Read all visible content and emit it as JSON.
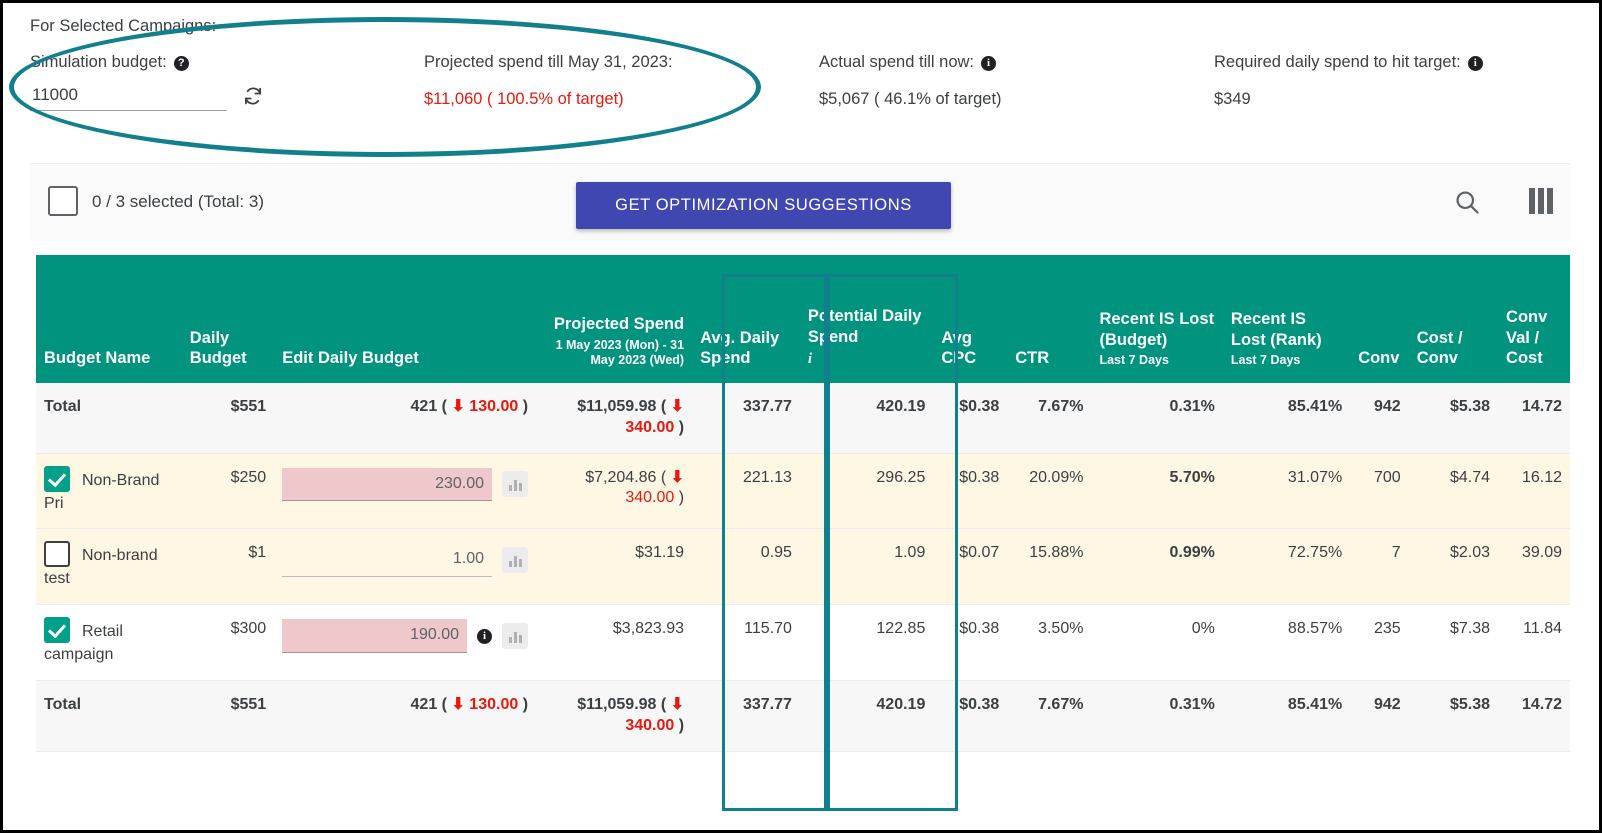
{
  "summary": {
    "title": "For Selected Campaigns:",
    "metrics": [
      {
        "label": "Simulation budget:",
        "icon": "help-icon",
        "input_value": "11000",
        "input_placeholder": "",
        "refresh_icon": "refresh-icon"
      },
      {
        "label": "Projected spend till May 31, 2023:",
        "value": "$11,060 ( 100.5% of target)",
        "value_color": "#e8190e"
      },
      {
        "label": "Actual spend till now:",
        "icon": "info-icon",
        "value": "$5,067 ( 46.1% of target)"
      },
      {
        "label": "Required daily spend to hit target:",
        "icon": "info-icon",
        "value": "$349"
      }
    ]
  },
  "toolbar": {
    "select_all_checked": false,
    "selected_text": "0 / 3 selected (Total: 3)",
    "button_label": "GET OPTIMIZATION SUGGESTIONS",
    "button_color": "#4147b0",
    "search_icon": "search-icon",
    "columns_icon": "columns-icon"
  },
  "table": {
    "header_color": "#00947e",
    "columns": [
      {
        "label": "Budget Name",
        "sub": ""
      },
      {
        "label": "Daily Budget",
        "sub": ""
      },
      {
        "label": "Edit Daily Budget",
        "sub": ""
      },
      {
        "label": "Projected Spend",
        "sub": "1 May 2023 (Mon) - 31 May 2023 (Wed)"
      },
      {
        "label": "Avg. Daily Spend",
        "sub": ""
      },
      {
        "label": "Potential Daily Spend",
        "sub": ""
      },
      {
        "label": "Avg CPC",
        "sub": ""
      },
      {
        "label": "CTR",
        "sub": ""
      },
      {
        "label": "Recent IS Lost (Budget)",
        "sub": "Last 7 Days"
      },
      {
        "label": "Recent IS Lost (Rank)",
        "sub": "Last 7 Days"
      },
      {
        "label": "Conv",
        "sub": ""
      },
      {
        "label": "Cost / Conv",
        "sub": ""
      },
      {
        "label": "Conv Val / Cost",
        "sub": ""
      }
    ],
    "total_row": {
      "name": "Total",
      "daily_budget": "$551",
      "edit_prefix": "421 (",
      "edit_delta": "130.00",
      "edit_suffix": ")",
      "projected_spend": "$11,059.98  (",
      "projected_delta": "340.00",
      "projected_suffix": ")",
      "avg_daily_spend": "337.77",
      "potential_daily_spend": "420.19",
      "avg_cpc": "$0.38",
      "ctr": "7.67%",
      "is_lost_budget": "0.31%",
      "is_lost_rank": "85.41%",
      "conv": "942",
      "cost_per_conv": "$5.38",
      "conv_val_cost": "14.72"
    },
    "rows": [
      {
        "checked": true,
        "name": "Non-Brand Pri",
        "daily_budget": "$250",
        "edit_value": "230.00",
        "edit_changed": true,
        "has_info": false,
        "projected_spend": "$7,204.86  (",
        "projected_delta": "340.00",
        "projected_suffix": ")",
        "avg_daily_spend": "221.13",
        "potential_daily_spend": "296.25",
        "avg_cpc": "$0.38",
        "ctr": "20.09%",
        "is_lost_budget": "5.70%",
        "is_lost_budget_bold": true,
        "is_lost_rank": "31.07%",
        "conv": "700",
        "cost_per_conv": "$4.74",
        "conv_val_cost": "16.12"
      },
      {
        "checked": false,
        "name": "Non-brand test",
        "daily_budget": "$1",
        "edit_value": "1.00",
        "edit_changed": false,
        "has_info": false,
        "projected_spend": "$31.19",
        "projected_delta": "",
        "projected_suffix": "",
        "avg_daily_spend": "0.95",
        "potential_daily_spend": "1.09",
        "avg_cpc": "$0.07",
        "ctr": "15.88%",
        "is_lost_budget": "0.99%",
        "is_lost_budget_bold": true,
        "is_lost_rank": "72.75%",
        "conv": "7",
        "cost_per_conv": "$2.03",
        "conv_val_cost": "39.09"
      },
      {
        "checked": true,
        "name": "Retail campaign",
        "daily_budget": "$300",
        "edit_value": "190.00",
        "edit_changed": true,
        "has_info": true,
        "projected_spend": "$3,823.93",
        "projected_delta": "",
        "projected_suffix": "",
        "avg_daily_spend": "115.70",
        "potential_daily_spend": "122.85",
        "avg_cpc": "$0.38",
        "ctr": "3.50%",
        "is_lost_budget": "0%",
        "is_lost_budget_bold": false,
        "is_lost_rank": "88.57%",
        "conv": "235",
        "cost_per_conv": "$7.38",
        "conv_val_cost": "11.84"
      }
    ],
    "footer_row": {
      "name": "Total",
      "daily_budget": "$551",
      "edit_prefix": "421 (",
      "edit_delta": "130.00",
      "edit_suffix": ")",
      "projected_spend": "$11,059.98  (",
      "projected_delta": "340.00",
      "projected_suffix": ")",
      "avg_daily_spend": "337.77",
      "potential_daily_spend": "420.19",
      "avg_cpc": "$0.38",
      "ctr": "7.67%",
      "is_lost_budget": "0.31%",
      "is_lost_rank": "85.41%",
      "conv": "942",
      "cost_per_conv": "$5.38",
      "conv_val_cost": "14.72"
    }
  },
  "annotations": {
    "ellipse_color": "#11808c",
    "highlight_color": "#11808c"
  }
}
